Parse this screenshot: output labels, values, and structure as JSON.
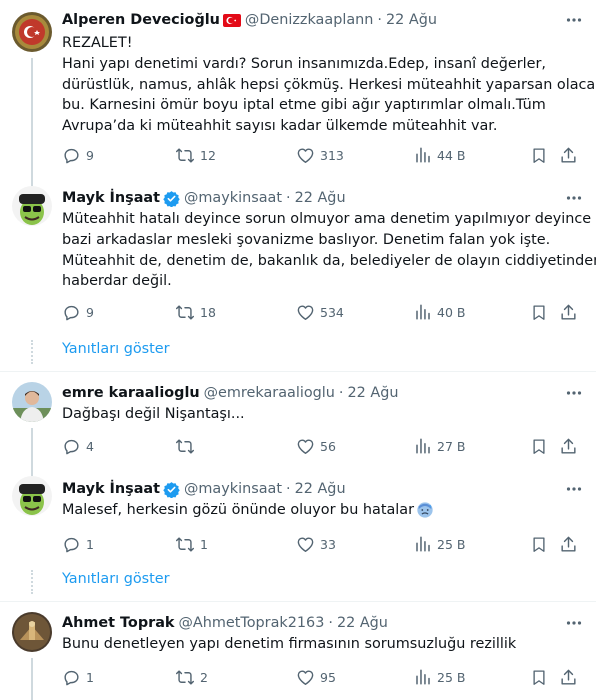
{
  "colors": {
    "accent": "#1d9bf0",
    "muted": "#536471",
    "text": "#0f1419"
  },
  "tweets": [
    {
      "name": "Alperen Devecioğlu",
      "handle": "@Denizzkaaplann",
      "time": "22 Ağu",
      "badge": "turkish-flag-icon",
      "lines": [
        "REZALET!",
        "Hani yapı denetimi vardı? Sorun insanımızda.Edep, insanî değerler,",
        "dürüstlük, namus, ahlâk hepsi çökmüş. Herkesi müteahhit yaparsan olacağı",
        "bu. Karnesini ömür boyu iptal etme gibi ağır yaptırımlar olmalı.Tüm",
        "Avrupa’da ki müteahhit sayısı kadar ülkemde müteahhit var."
      ],
      "stats": {
        "replies": "9",
        "reposts": "12",
        "likes": "313",
        "views": "44 B"
      }
    },
    {
      "name": "Mayk İnşaat",
      "handle": "@maykinsaat",
      "time": "22 Ağu",
      "badge": "verified-badge-icon",
      "lines": [
        "Müteahhit hatalı deyince sorun olmuyor ama denetim yapılmıyor deyince",
        "bazi arkadaslar mesleki şovanizme baslıyor. Denetim falan yok işte.",
        "Müteahhit de, denetim de, bakanlık da, belediyeler de olayın ciddiyetinden",
        "haberdar değil."
      ],
      "stats": {
        "replies": "9",
        "reposts": "18",
        "likes": "534",
        "views": "40 B"
      }
    },
    {
      "name": "emre karaalioglu",
      "handle": "@emrekaraalioglu",
      "time": "22 Ağu",
      "lines": [
        "Dağbaşı değil Nişantaşı..."
      ],
      "stats": {
        "replies": "4",
        "reposts": "",
        "likes": "56",
        "views": "27 B"
      }
    },
    {
      "name": "Mayk İnşaat",
      "handle": "@maykinsaat",
      "time": "22 Ağu",
      "badge": "verified-badge-icon",
      "lines": [
        "Malesef, herkesin gözü önünde oluyor bu hatalar"
      ],
      "emoji": "cold-sweat-emoji",
      "stats": {
        "replies": "1",
        "reposts": "1",
        "likes": "33",
        "views": "25 B"
      }
    },
    {
      "name": "Ahmet Toprak",
      "handle": "@AhmetToprak2163",
      "time": "22 Ağu",
      "lines": [
        "Bunu denetleyen yapı denetim firmasının sorumsuzluğu rezillik"
      ],
      "stats": {
        "replies": "1",
        "reposts": "2",
        "likes": "95",
        "views": "25 B"
      }
    }
  ],
  "show_replies_label": "Yanıtları göster"
}
